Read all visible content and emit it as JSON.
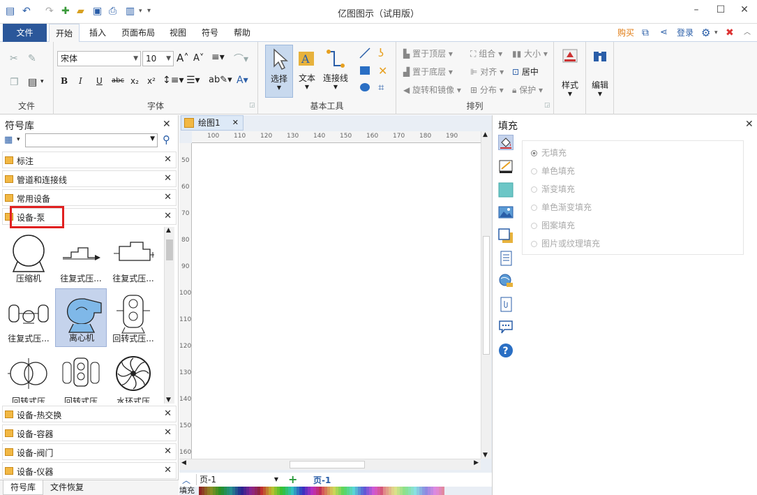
{
  "app": {
    "title": "亿图图示（试用版）"
  },
  "menu": {
    "file": "文件",
    "tabs": [
      "开始",
      "插入",
      "页面布局",
      "视图",
      "符号",
      "帮助"
    ],
    "buy": "购买",
    "login": "登录"
  },
  "ribbon": {
    "file_group_label": "文件",
    "font": {
      "label": "字体",
      "font_name": "宋体",
      "font_size": "10"
    },
    "basic_tools": {
      "label": "基本工具",
      "select": "选择",
      "text": "文本",
      "connector": "连接线"
    },
    "arrange": {
      "label": "排列",
      "bring_front": "置于顶层",
      "send_back": "置于底层",
      "rotate": "旋转和镜像",
      "group": "组合",
      "align": "对齐",
      "distribute": "分布",
      "size": "大小",
      "center": "居中",
      "protect": "保护"
    },
    "style": "样式",
    "edit": "编辑"
  },
  "symbol_library": {
    "title": "符号库",
    "libraries_top": [
      "标注",
      "管道和连接线",
      "常用设备",
      "设备-泵"
    ],
    "shapes": [
      {
        "label": "压缩机"
      },
      {
        "label": "往复式压..."
      },
      {
        "label": "往复式压..."
      },
      {
        "label": "往复式压..."
      },
      {
        "label": "离心机"
      },
      {
        "label": "回转式压..."
      },
      {
        "label": "回转式压"
      },
      {
        "label": "回转式压"
      },
      {
        "label": "水环式压"
      }
    ],
    "libraries_bottom": [
      "设备-热交换",
      "设备-容器",
      "设备-阀门",
      "设备-仪器"
    ],
    "bottom_tabs": [
      "符号库",
      "文件恢复"
    ]
  },
  "document": {
    "tab": "绘图1",
    "ruler_h": [
      "100",
      "110",
      "120",
      "130",
      "140",
      "150",
      "160",
      "170",
      "180",
      "190"
    ],
    "ruler_v": [
      "50",
      "60",
      "70",
      "80",
      "90",
      "100",
      "110",
      "120",
      "130",
      "140",
      "150",
      "160"
    ],
    "page_select": "页-1",
    "page_tab": "页-1",
    "fill_label": "填充"
  },
  "fill_panel": {
    "title": "填充",
    "options": [
      "无填充",
      "单色填充",
      "渐变填充",
      "单色渐变填充",
      "图案填充",
      "图片或纹理填充"
    ]
  },
  "colors": {
    "accent": "#2b579a",
    "highlight_box": "#e02020"
  }
}
